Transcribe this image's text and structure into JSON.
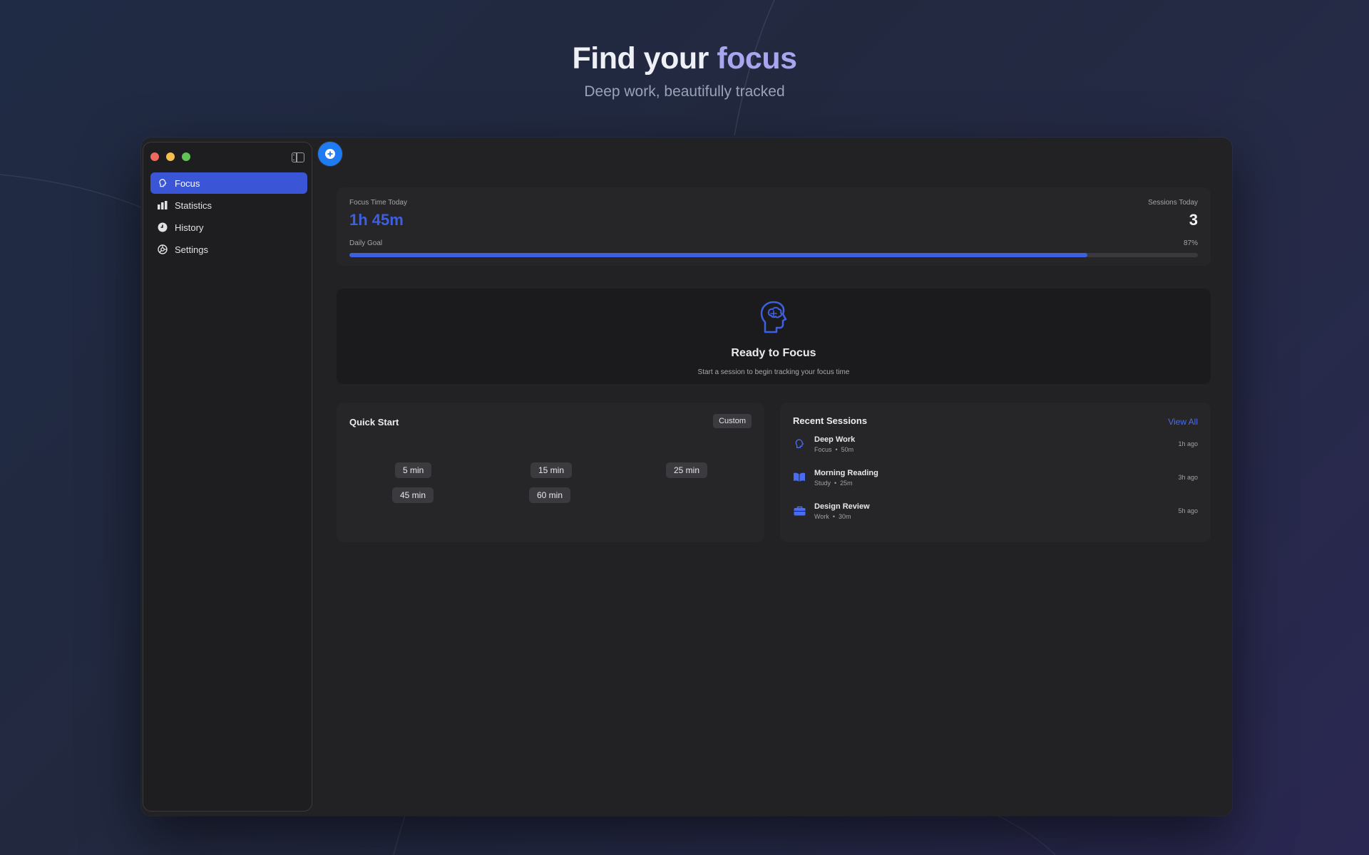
{
  "hero": {
    "title_prefix": "Find your",
    "title_accent": "focus",
    "subtitle": "Deep work, beautifully tracked"
  },
  "sidebar": {
    "items": [
      {
        "label": "Focus",
        "icon": "head-icon",
        "active": true
      },
      {
        "label": "Statistics",
        "icon": "bar-chart-icon",
        "active": false
      },
      {
        "label": "History",
        "icon": "clock-icon",
        "active": false
      },
      {
        "label": "Settings",
        "icon": "gear-icon",
        "active": false
      }
    ]
  },
  "stats": {
    "focus_time_label": "Focus Time Today",
    "focus_time_value": "1h 45m",
    "sessions_label": "Sessions Today",
    "sessions_value": "3",
    "goal_label": "Daily Goal",
    "goal_percent_text": "87%",
    "goal_progress": 0.87
  },
  "ready": {
    "title": "Ready to Focus",
    "subtitle": "Start a session to begin tracking your focus time"
  },
  "quick_start": {
    "title": "Quick Start",
    "custom_label": "Custom",
    "durations": [
      "5 min",
      "15 min",
      "25 min",
      "45 min",
      "60 min"
    ]
  },
  "recent": {
    "title": "Recent Sessions",
    "view_all_label": "View All",
    "sessions": [
      {
        "name": "Deep Work",
        "category": "Focus",
        "duration": "50m",
        "ago": "1h ago",
        "icon": "head-icon"
      },
      {
        "name": "Morning Reading",
        "category": "Study",
        "duration": "25m",
        "ago": "3h ago",
        "icon": "book-icon"
      },
      {
        "name": "Design Review",
        "category": "Work",
        "duration": "30m",
        "ago": "5h ago",
        "icon": "briefcase-icon"
      }
    ]
  },
  "colors": {
    "accent": "#3d5fe0",
    "hero_accent": "#a9a5ef",
    "add_button": "#1f7bf2"
  }
}
